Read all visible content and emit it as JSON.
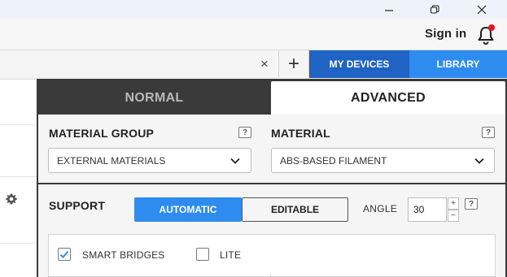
{
  "window": {
    "minimize_icon": "minimize-icon",
    "restore_icon": "restore-icon",
    "close_icon": "close-icon"
  },
  "account": {
    "sign_in_label": "Sign in",
    "notification_icon": "bell-icon",
    "notification_dot_color": "#e81123"
  },
  "tabs_bar": {
    "close_label": "×",
    "add_label": "+",
    "my_devices_label": "MY DEVICES",
    "library_label": "LIBRARY",
    "my_devices_color": "#1f63c4",
    "library_color": "#2e8cf0"
  },
  "panel": {
    "mode_tabs": [
      {
        "label": "NORMAL",
        "active": false
      },
      {
        "label": "ADVANCED",
        "active": true
      }
    ],
    "material_group": {
      "label": "MATERIAL GROUP",
      "help": "?",
      "value": "EXTERNAL MATERIALS"
    },
    "material": {
      "label": "MATERIAL",
      "help": "?",
      "value": "ABS-BASED FILAMENT"
    },
    "support": {
      "label": "SUPPORT",
      "automatic_label": "AUTOMATIC",
      "editable_label": "EDITABLE",
      "selected": "AUTOMATIC",
      "angle_label": "ANGLE",
      "angle_value": "30",
      "increment": "+",
      "decrement": "−",
      "help": "?"
    },
    "options": [
      {
        "label": "SMART BRIDGES",
        "checked": true
      },
      {
        "label": "LITE",
        "checked": false
      }
    ]
  },
  "colors": {
    "accent": "#2e8cf0",
    "panel_dark": "#3a3a3a"
  }
}
